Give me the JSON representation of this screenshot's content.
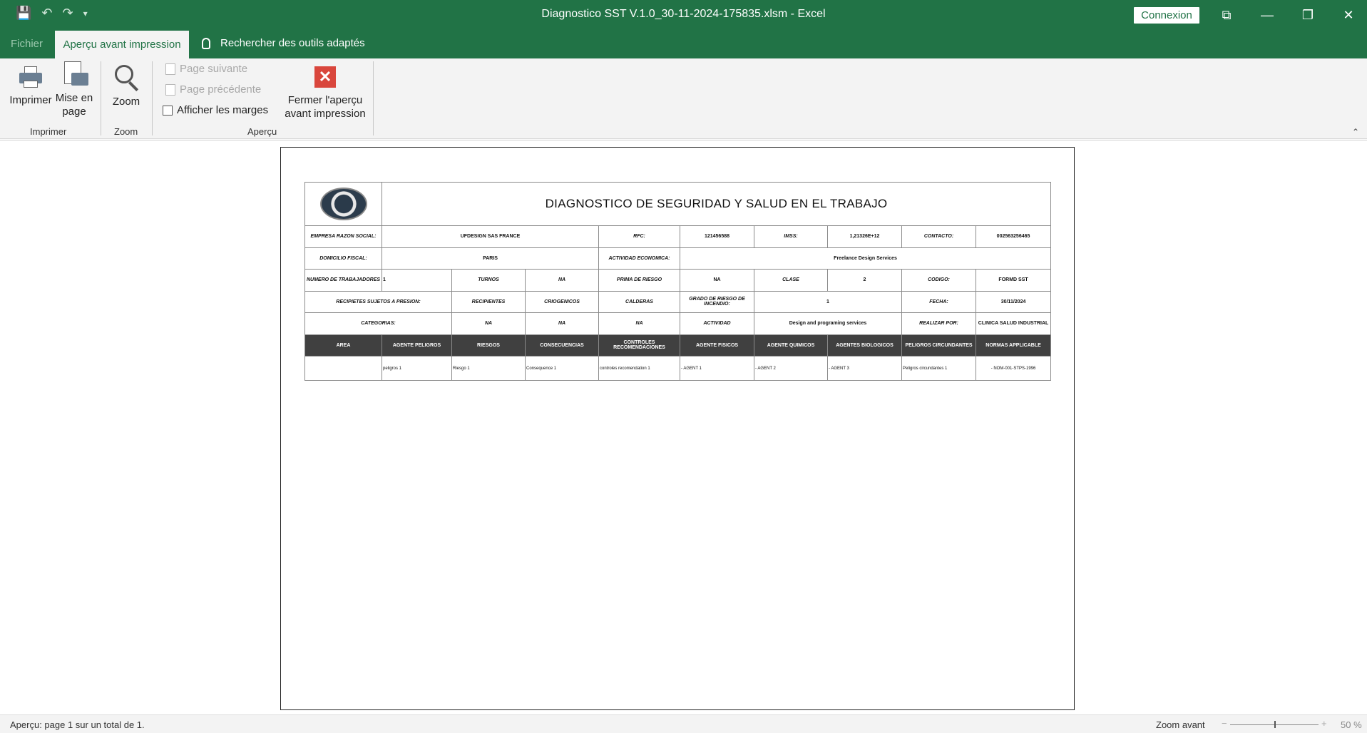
{
  "window": {
    "title": "Diagnostico SST V.1.0_30-11-2024-175835.xlsm  -  Excel",
    "signin_label": "Connexion",
    "qat": {
      "save_icon": "save-icon",
      "undo_icon": "undo-icon",
      "redo_icon": "redo-icon",
      "customize_icon": "customize-qat-icon"
    },
    "controls": {
      "restore_ribbon": "⧉",
      "minimize": "—",
      "maximize": "❐",
      "close": "✕"
    }
  },
  "tabs": {
    "fichier": "Fichier",
    "active": "Aperçu avant impression",
    "search": "Rechercher des outils adaptés"
  },
  "ribbon": {
    "print_label": "Imprimer",
    "page_setup_line1": "Mise en",
    "page_setup_line2": "page",
    "zoom_label": "Zoom",
    "next_page": "Page suivante",
    "prev_page": "Page précédente",
    "show_margins": "Afficher les marges",
    "close_line1": "Fermer l'aperçu",
    "close_line2": "avant impression",
    "group_print": "Imprimer",
    "group_zoom": "Zoom",
    "group_preview": "Aperçu"
  },
  "sheet": {
    "title": "DIAGNOSTICO DE SEGURIDAD Y SALUD EN EL TRABAJO",
    "r1": [
      "EMPRESA RAZON SOCIAL:",
      "UFDESIGN SAS FRANCE",
      "RFC:",
      "121456588",
      "IMSS:",
      "1,21326E+12",
      "CONTACTO:",
      "002563256465"
    ],
    "r2": [
      "DOMICILIO FISCAL:",
      "PARIS",
      "ACTIVIDAD ECONOMICA:",
      "Freelance Design Services"
    ],
    "r3": [
      "NUMERO DE TRABAJADORES",
      "1",
      "TURNOS",
      "NA",
      "PRIMA DE RIESGO",
      "NA",
      "CLASE",
      "2",
      "CODIGO:",
      "FORMD SST"
    ],
    "r4": [
      "RECIPIETES SUJETOS A PRESION:",
      "RECIPIENTES",
      "CRIOGENICOS",
      "CALDERAS",
      "GRADO DE RIESGO DE INCENDIO:",
      "1",
      "FECHA:",
      "30/11/2024"
    ],
    "r5": [
      "CATEGORIAS:",
      "NA",
      "NA",
      "NA",
      "ACTIVIDAD",
      "Design and programing services",
      "REALIZAR POR:",
      "CLINICA SALUD INDUSTRIAL"
    ],
    "headers": [
      "AREA",
      "AGENTE PELIGROS",
      "RIESGOS",
      "CONSECUENCIAS",
      "CONTROLES RECOMENDACIONES",
      "AGENTE FISICOS",
      "AGENTE QUIMICOS",
      "AGENTES BIOLOGICOS",
      "PELIGROS CIRCUNDANTES",
      "NORMAS APPLICABLE"
    ],
    "data_row": [
      "",
      "peligros 1",
      "Riesgo 1",
      "Consequence 1",
      "controles recomendation 1",
      "- AGENT 1",
      "- AGENT 2",
      "- AGENT 3",
      "Peligros circundantes 1",
      "- NOM-001-STPS-1996"
    ]
  },
  "status": {
    "page_info": "Aperçu: page 1 sur un total de 1.",
    "zoom_label": "Zoom avant",
    "zoom_percent": "50 %",
    "zoom_level": 0.5
  }
}
